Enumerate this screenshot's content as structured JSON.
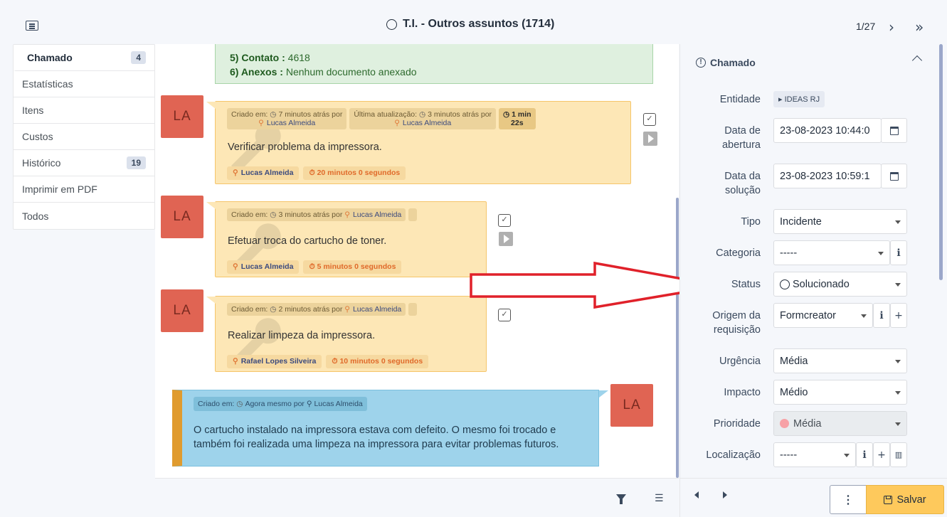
{
  "header": {
    "title": "T.I. - Outros assuntos (1714)",
    "pager": "1/27"
  },
  "tabs": [
    {
      "label": "Chamado",
      "badge": "4"
    },
    {
      "label": "Estatísticas",
      "badge": ""
    },
    {
      "label": "Itens",
      "badge": ""
    },
    {
      "label": "Custos",
      "badge": ""
    },
    {
      "label": "Histórico",
      "badge": "19"
    },
    {
      "label": "Imprimir em PDF",
      "badge": ""
    },
    {
      "label": "Todos",
      "badge": ""
    }
  ],
  "description": {
    "contact_label": "5) Contato :",
    "contact_value": "4618",
    "attach_label": "6) Anexos :",
    "attach_value": "Nenhum documento anexado"
  },
  "tasks": [
    {
      "avatar": "LA",
      "created_label": "Criado em:",
      "created_value": "7 minutos atrás por",
      "created_by": "Lucas Almeida",
      "updated_label": "Última atualização:",
      "updated_value": "3 minutos atrás por",
      "updated_by": "Lucas Almeida",
      "duration_line1": "1 min",
      "duration_line2": "22s",
      "text": "Verificar problema da impressora.",
      "assignee": "Lucas Almeida",
      "time": "20 minutos 0 segundos"
    },
    {
      "avatar": "LA",
      "created_label": "Criado em:",
      "created_value": "3 minutos atrás por",
      "created_by": "Lucas Almeida",
      "text": "Efetuar troca do cartucho de toner.",
      "assignee": "Lucas Almeida",
      "time": "5 minutos 0 segundos"
    },
    {
      "avatar": "LA",
      "created_label": "Criado em:",
      "created_value": "2 minutos atrás por",
      "created_by": "Lucas Almeida",
      "text": "Realizar limpeza da impressora.",
      "assignee": "Rafael Lopes Silveira",
      "time": "10 minutos 0 segundos"
    }
  ],
  "followup": {
    "avatar": "LA",
    "created_label": "Criado em:",
    "created_value": "Agora mesmo por",
    "created_by": "Lucas Almeida",
    "text": "O cartucho instalado na impressora estava com defeito. O mesmo foi trocado e também foi realizada uma limpeza na impressora para evitar problemas futuros."
  },
  "panel": {
    "header": "Chamado",
    "entidade_label": "Entidade",
    "entidade_value": "IDEAS RJ",
    "abertura_label": "Data de abertura",
    "abertura_value": "23-08-2023 10:44:0",
    "solucao_label": "Data da solução",
    "solucao_value": "23-08-2023 10:59:1",
    "tipo_label": "Tipo",
    "tipo_value": "Incidente",
    "categoria_label": "Categoria",
    "categoria_value": "-----",
    "status_label": "Status",
    "status_value": "Solucionado",
    "origem_label": "Origem da requisição",
    "origem_value": "Formcreator",
    "urgencia_label": "Urgência",
    "urgencia_value": "Média",
    "impacto_label": "Impacto",
    "impacto_value": "Médio",
    "prioridade_label": "Prioridade",
    "prioridade_value": "Média",
    "localizacao_label": "Localização",
    "localizacao_value": "-----",
    "save_label": "Salvar",
    "kebab": "⋮"
  },
  "colors": {
    "task_bg": "#fde7b6",
    "followup_bg": "#9ed3eb",
    "avatar_bg": "#e06453",
    "save_bg": "#fec95c",
    "arrow": "#e0212a",
    "priority_dot": "#f7a1a6"
  },
  "icons": [
    "menu-icon",
    "status-circle-icon",
    "chevron-right-icon",
    "double-chevron-right-icon",
    "clock-icon",
    "user-icon",
    "stopwatch-icon",
    "checkbox-icon",
    "play-icon",
    "filter-icon",
    "checklist-icon",
    "calendar-icon",
    "info-icon",
    "plus-icon",
    "map-icon",
    "save-icon",
    "warning-circle-icon",
    "chevron-up-icon"
  ]
}
